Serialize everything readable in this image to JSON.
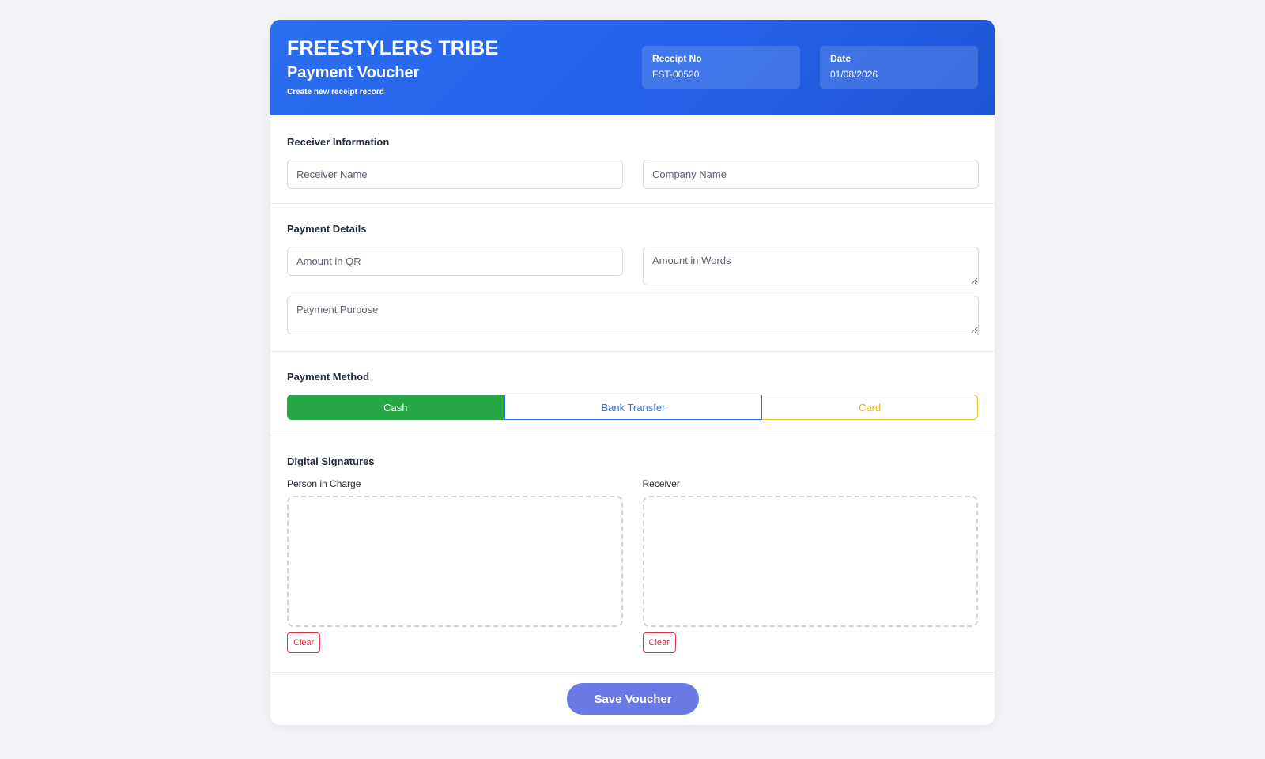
{
  "header": {
    "brand": "FREESTYLERS TRIBE",
    "title": "Payment Voucher",
    "subtitle": "Create new receipt record",
    "receipt_label": "Receipt No",
    "receipt_value": "FST-00520",
    "date_label": "Date",
    "date_value": "01/08/2026"
  },
  "receiver_info": {
    "title": "Receiver Information",
    "receiver_name_placeholder": "Receiver Name",
    "company_name_placeholder": "Company Name"
  },
  "payment_details": {
    "title": "Payment Details",
    "amount_qr_placeholder": "Amount in QR",
    "amount_words_placeholder": "Amount in Words",
    "purpose_placeholder": "Payment Purpose"
  },
  "payment_method": {
    "title": "Payment Method",
    "options": [
      "Cash",
      "Bank Transfer",
      "Card"
    ],
    "selected": "Cash",
    "colors": {
      "cash": "#28a745",
      "bank": "#2f6fed",
      "card": "#f0ad00"
    }
  },
  "signatures": {
    "title": "Digital Signatures",
    "person_label": "Person in Charge",
    "receiver_label": "Receiver",
    "clear_label": "Clear"
  },
  "footer": {
    "save_label": "Save Voucher"
  },
  "colors": {
    "header_blue": "#2563eb",
    "save_button": "#6a79e6",
    "clear_red": "#dc3545"
  }
}
